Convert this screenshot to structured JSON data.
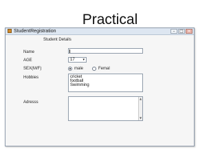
{
  "slide": {
    "title": "Practical"
  },
  "window": {
    "title": "StudentRegistration",
    "controls": {
      "minimize": "–",
      "maximize": "□",
      "close": "×"
    }
  },
  "form": {
    "heading": "Student Details",
    "name": {
      "label": "Name",
      "value": ""
    },
    "age": {
      "label": "AGE",
      "value": "17",
      "arrow": "▾"
    },
    "sex": {
      "label": "SEX(M/F)",
      "options": [
        {
          "label": "male",
          "selected": true
        },
        {
          "label": "Femal",
          "selected": false
        }
      ]
    },
    "hobbies": {
      "label": "Hobbies",
      "items": [
        "cricket",
        "football",
        "Swimming"
      ]
    },
    "address": {
      "label": "Adresss",
      "value": "",
      "scroll_up": "▲",
      "scroll_down": "▼"
    }
  }
}
